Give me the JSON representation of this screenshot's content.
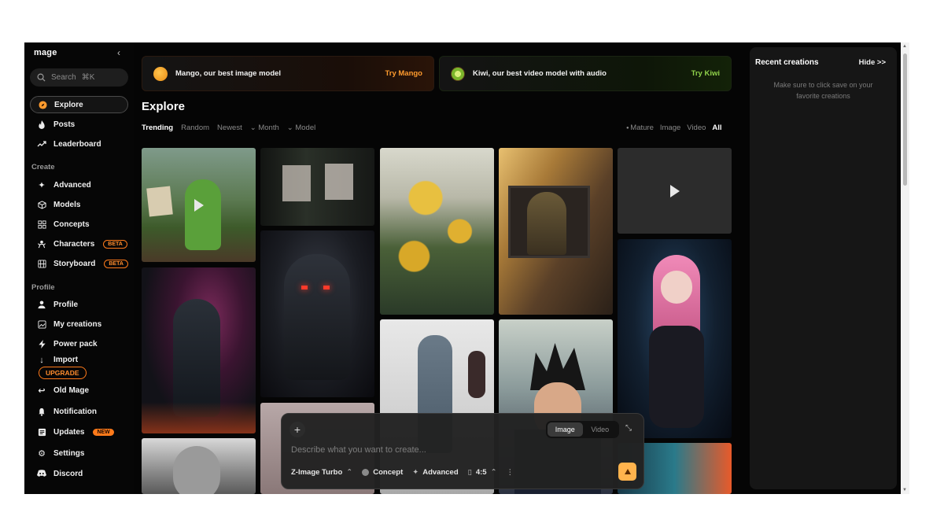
{
  "sidebar": {
    "brand": "mage",
    "collapse_icon": "chevron-left-icon",
    "search": {
      "placeholder": "Search",
      "shortcut": "⌘K"
    },
    "main_items": [
      {
        "label": "Explore",
        "icon": "compass-icon",
        "active": true
      },
      {
        "label": "Posts",
        "icon": "flame-icon"
      },
      {
        "label": "Leaderboard",
        "icon": "trending-icon"
      }
    ],
    "create_label": "Create",
    "create_items": [
      {
        "label": "Advanced",
        "icon": "sparkle-icon"
      },
      {
        "label": "Models",
        "icon": "cube-icon"
      },
      {
        "label": "Concepts",
        "icon": "grid-icon"
      },
      {
        "label": "Characters",
        "icon": "characters-icon",
        "badge": "BETA"
      },
      {
        "label": "Storyboard",
        "icon": "film-icon",
        "badge": "BETA"
      }
    ],
    "profile_label": "Profile",
    "profile_items": [
      {
        "label": "Profile",
        "icon": "user-icon"
      },
      {
        "label": "My creations",
        "icon": "image-icon"
      },
      {
        "label": "Power pack",
        "icon": "bolt-icon"
      },
      {
        "label": "Import",
        "icon": "download-icon"
      },
      {
        "label": "Old Mage",
        "icon": "back-icon"
      },
      {
        "label": "Notification",
        "icon": "bell-icon"
      },
      {
        "label": "Updates",
        "icon": "list-icon",
        "badge": "NEW"
      },
      {
        "label": "Settings",
        "icon": "gear-icon"
      },
      {
        "label": "Discord",
        "icon": "discord-icon"
      }
    ],
    "upgrade_label": "UPGRADE"
  },
  "banners": {
    "mango": {
      "text": "Mango, our best image model",
      "cta": "Try Mango"
    },
    "kiwi": {
      "text": "Kiwi, our best video model with audio",
      "cta": "Try Kiwi"
    }
  },
  "explore": {
    "title": "Explore",
    "sort_tabs": [
      "Trending",
      "Random",
      "Newest"
    ],
    "dropdowns": [
      "Month",
      "Model"
    ],
    "media_filters": {
      "mature": "Mature",
      "image": "Image",
      "video": "Video",
      "all": "All"
    }
  },
  "right_panel": {
    "title": "Recent creations",
    "hide_label": "Hide >>",
    "empty_message": "Make sure to click save on your favorite creations"
  },
  "composer": {
    "placeholder": "Describe what you want to create...",
    "mode_image": "Image",
    "mode_video": "Video",
    "model": "Z-Image Turbo",
    "concept": "Concept",
    "advanced": "Advanced",
    "ratio": "4:5"
  },
  "colors": {
    "accent": "#ff7a1a",
    "send_button": "#ffb34d",
    "kiwi_green": "#8fd14a"
  }
}
